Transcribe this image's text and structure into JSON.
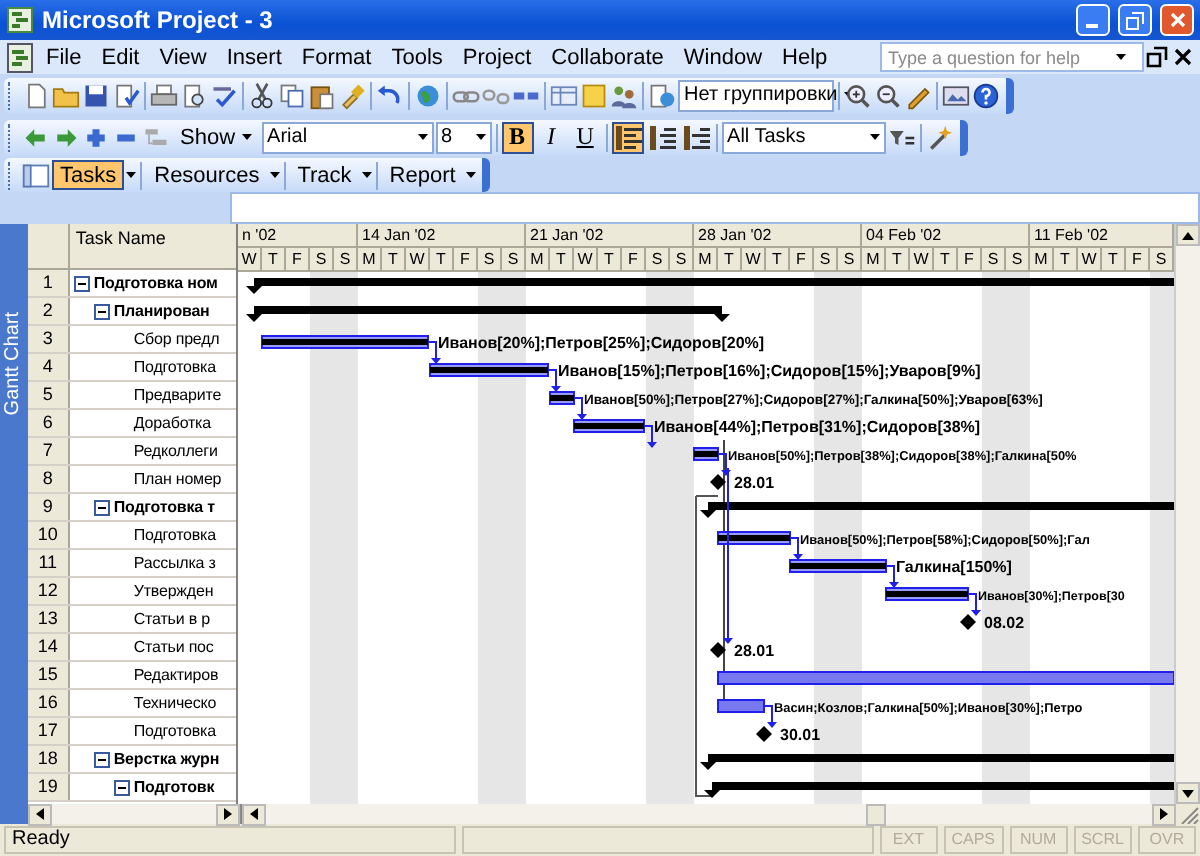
{
  "window": {
    "title": "Microsoft Project - 3"
  },
  "menu": {
    "items": [
      "File",
      "Edit",
      "View",
      "Insert",
      "Format",
      "Tools",
      "Project",
      "Collaborate",
      "Window",
      "Help"
    ],
    "help_field": {
      "placeholder": "Type a question for help"
    }
  },
  "standard_toolbar": {
    "grouping": {
      "value": "Нет группировки"
    }
  },
  "formatting_toolbar": {
    "show": "Show",
    "font": {
      "value": "Arial"
    },
    "size": {
      "value": "8"
    },
    "styles": [
      {
        "label": "B",
        "on": true
      },
      {
        "label": "I",
        "on": false
      },
      {
        "label": "U",
        "on": false
      }
    ],
    "alignment": [
      {
        "kind": "left",
        "selected": true
      },
      {
        "kind": "center",
        "selected": false
      },
      {
        "kind": "right",
        "selected": false
      }
    ],
    "filter": {
      "value": "All Tasks"
    }
  },
  "guide_toolbar": {
    "buttons": [
      {
        "label": "Tasks",
        "selected": true
      },
      {
        "label": "Resources",
        "selected": false
      },
      {
        "label": "Track",
        "selected": false
      },
      {
        "label": "Report",
        "selected": false
      }
    ]
  },
  "view_bar": {
    "label": "Gantt Chart"
  },
  "table": {
    "columns": [
      "Task Name"
    ],
    "tasks": [
      {
        "num": "1",
        "name": "Подготовка ном",
        "kind": "summary",
        "expanded": true,
        "children": [
          {
            "num": "2",
            "name": "Планирован",
            "kind": "summary",
            "expanded": true,
            "children": [
              {
                "num": "3",
                "name": "Сбор предл",
                "kind": "task",
                "complete": true,
                "label": "Иванов[20%];Петров[25%];Сидоров[20%]"
              },
              {
                "num": "4",
                "name": "Подготовка",
                "kind": "task",
                "complete": true,
                "label": "Иванов[15%];Петров[16%];Сидоров[15%];Уваров[9%]"
              },
              {
                "num": "5",
                "name": "Предварите",
                "kind": "task",
                "complete": true,
                "label": "Иванов[50%];Петров[27%];Сидоров[27%];Галкина[50%];Уваров[63%]"
              },
              {
                "num": "6",
                "name": "Доработка",
                "kind": "task",
                "complete": true,
                "label": "Иванов[44%];Петров[31%];Сидоров[38%]"
              },
              {
                "num": "7",
                "name": "Редколлеги",
                "kind": "task",
                "complete": true,
                "label": "Иванов[50%];Петров[38%];Сидоров[38%];Галкина[50%"
              },
              {
                "num": "8",
                "name": "План номер",
                "kind": "milestone",
                "label": "28.01"
              }
            ]
          },
          {
            "num": "9",
            "name": "Подготовка т",
            "kind": "summary",
            "expanded": true,
            "children": [
              {
                "num": "10",
                "name": "Подготовка",
                "kind": "task",
                "complete": true,
                "label": "Иванов[50%];Петров[58%];Сидоров[50%];Гал"
              },
              {
                "num": "11",
                "name": "Рассылка з",
                "kind": "task",
                "complete": true,
                "label": "Галкина[150%]"
              },
              {
                "num": "12",
                "name": "Утвержден",
                "kind": "task",
                "complete": true,
                "label": "Иванов[30%];Петров[30"
              },
              {
                "num": "13",
                "name": "Статьи в р",
                "kind": "milestone",
                "label": "08.02"
              },
              {
                "num": "14",
                "name": "Статьи пос",
                "kind": "milestone",
                "label": "28.01"
              },
              {
                "num": "15",
                "name": "Редактиров",
                "kind": "task",
                "complete": false
              },
              {
                "num": "16",
                "name": "Техническо",
                "kind": "task",
                "complete": false,
                "label": "Васин;Козлов;Галкина[50%];Иванов[30%];Петро"
              },
              {
                "num": "17",
                "name": "Подготовка",
                "kind": "milestone",
                "label": "30.01"
              }
            ]
          },
          {
            "num": "18",
            "name": "Верстка журн",
            "kind": "summary",
            "expanded": true,
            "children": [
              {
                "num": "19",
                "name": "Подготовк",
                "kind": "summary",
                "expanded": true
              }
            ]
          }
        ]
      }
    ]
  },
  "timescale": {
    "weeks": [
      "n '02",
      "14 Jan '02",
      "21 Jan '02",
      "28 Jan '02",
      "04 Feb '02",
      "11 Feb '02"
    ],
    "days": [
      "W",
      "T",
      "F",
      "S",
      "S",
      "M",
      "T",
      "W",
      "T",
      "F",
      "S",
      "S",
      "M",
      "T",
      "W",
      "T",
      "F",
      "S",
      "S",
      "M",
      "T",
      "W",
      "T",
      "F",
      "S",
      "S",
      "M",
      "T",
      "W",
      "T",
      "F",
      "S",
      "S",
      "M",
      "T",
      "W",
      "T",
      "F",
      "S"
    ]
  },
  "status_bar": {
    "text": "Ready",
    "indicators": [
      {
        "label": "EXT",
        "on": false
      },
      {
        "label": "CAPS",
        "on": false
      },
      {
        "label": "NUM",
        "on": false
      },
      {
        "label": "SCRL",
        "on": false
      },
      {
        "label": "OVR",
        "on": false
      }
    ]
  }
}
